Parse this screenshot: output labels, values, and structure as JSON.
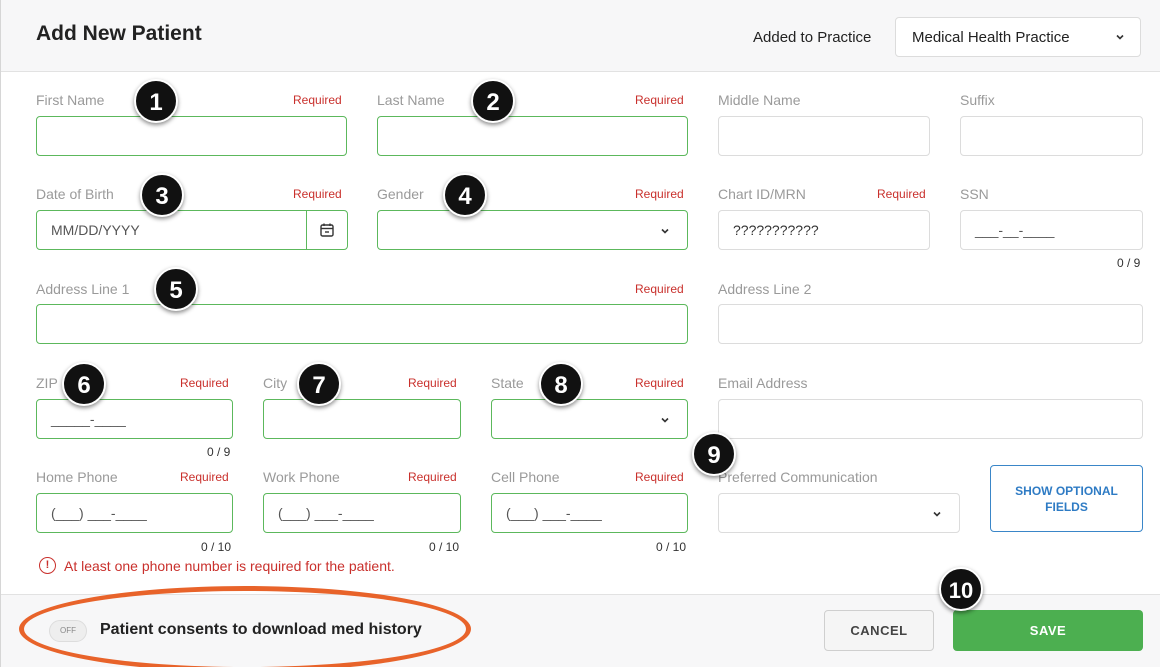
{
  "header": {
    "title": "Add New Patient",
    "practice_label": "Added to Practice",
    "practice_value": "Medical Health Practice"
  },
  "required_text": "Required",
  "fields": {
    "first_name": {
      "label": "First Name",
      "value": ""
    },
    "last_name": {
      "label": "Last Name",
      "value": ""
    },
    "middle_name": {
      "label": "Middle Name",
      "value": ""
    },
    "suffix": {
      "label": "Suffix",
      "value": ""
    },
    "dob": {
      "label": "Date of Birth",
      "placeholder": "MM/DD/YYYY"
    },
    "gender": {
      "label": "Gender",
      "value": ""
    },
    "chart_id": {
      "label": "Chart ID/MRN",
      "value": "???????????"
    },
    "ssn": {
      "label": "SSN",
      "placeholder": "___-__-____",
      "counter": "0 / 9"
    },
    "address1": {
      "label": "Address Line 1",
      "value": ""
    },
    "address2": {
      "label": "Address Line 2",
      "value": ""
    },
    "zip": {
      "label": "ZIP",
      "placeholder": "_____-____",
      "counter": "0 / 9"
    },
    "city": {
      "label": "City",
      "value": ""
    },
    "state": {
      "label": "State",
      "value": ""
    },
    "email": {
      "label": "Email Address",
      "value": ""
    },
    "home_phone": {
      "label": "Home Phone",
      "placeholder": "(___) ___-____",
      "counter": "0 / 10"
    },
    "work_phone": {
      "label": "Work Phone",
      "placeholder": "(___) ___-____",
      "counter": "0 / 10"
    },
    "cell_phone": {
      "label": "Cell Phone",
      "placeholder": "(___) ___-____",
      "counter": "0 / 10"
    },
    "preferred_comm": {
      "label": "Preferred Communication",
      "value": ""
    }
  },
  "error_message": "At least one phone number is required for the patient.",
  "error_icon": "!",
  "show_optional_label": "SHOW OPTIONAL FIELDS",
  "footer": {
    "toggle_state": "OFF",
    "consent_label": "Patient consents to download med history",
    "cancel_label": "CANCEL",
    "save_label": "SAVE"
  },
  "markers": [
    "1",
    "2",
    "3",
    "4",
    "5",
    "6",
    "7",
    "8",
    "9",
    "10"
  ],
  "colors": {
    "required": "#c9302c",
    "valid_border": "#5cb85c",
    "save": "#4caf50",
    "accent_blue": "#2e7bc4",
    "highlight_oval": "#e8632a"
  }
}
